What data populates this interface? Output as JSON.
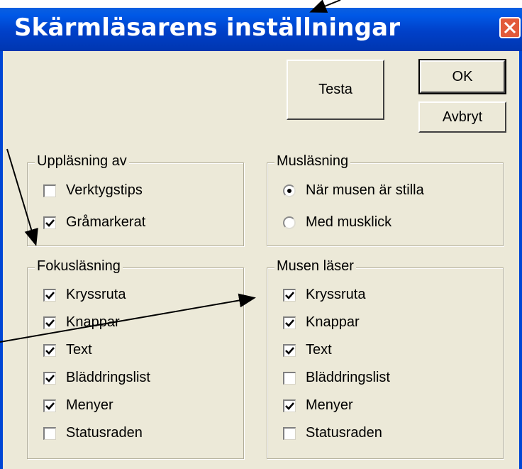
{
  "window": {
    "title": "Skärmläsarens inställningar",
    "close_icon": "close-icon"
  },
  "buttons": {
    "test_label": "Testa",
    "ok_label": "OK",
    "cancel_label": "Avbryt"
  },
  "groups": {
    "uppl": {
      "title": "Uppläsning av",
      "items": [
        {
          "label": "Verktygstips",
          "checked": false
        },
        {
          "label": "Gråmarkerat",
          "checked": true
        }
      ]
    },
    "mus": {
      "title": "Musläsning",
      "items": [
        {
          "label": "När musen är stilla",
          "selected": true
        },
        {
          "label": "Med musklick",
          "selected": false
        }
      ]
    },
    "fokus": {
      "title": "Fokusläsning",
      "items": [
        {
          "label": "Kryssruta",
          "checked": true
        },
        {
          "label": "Knappar",
          "checked": true
        },
        {
          "label": "Text",
          "checked": true
        },
        {
          "label": "Bläddringslist",
          "checked": true
        },
        {
          "label": "Menyer",
          "checked": true
        },
        {
          "label": "Statusraden",
          "checked": false
        }
      ]
    },
    "musen": {
      "title": "Musen läser",
      "items": [
        {
          "label": "Kryssruta",
          "checked": true
        },
        {
          "label": "Knappar",
          "checked": true
        },
        {
          "label": "Text",
          "checked": true
        },
        {
          "label": "Bläddringslist",
          "checked": false
        },
        {
          "label": "Menyer",
          "checked": true
        },
        {
          "label": "Statusraden",
          "checked": false
        }
      ]
    }
  },
  "colors": {
    "titlebar": "#0040c8",
    "dialog_bg": "#ece9d8",
    "close_bg": "#e25a3a"
  }
}
